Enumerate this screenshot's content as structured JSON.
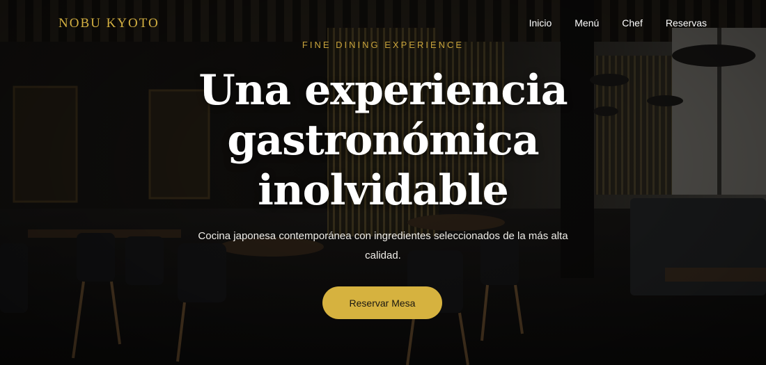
{
  "brand": {
    "logo_text": "NOBU KYOTO",
    "accent_color": "#d4b041"
  },
  "nav": {
    "items": [
      "Inicio",
      "Menú",
      "Chef",
      "Reservas"
    ]
  },
  "hero": {
    "eyebrow": "FINE DINING EXPERIENCE",
    "headline": "Una experiencia gastronómica inolvidable",
    "subtitle": "Cocina japonesa contemporánea con ingredientes seleccionados de la más alta calidad.",
    "cta_label": "Reservar Mesa",
    "background_description_icon": "restaurant-interior-photo"
  }
}
